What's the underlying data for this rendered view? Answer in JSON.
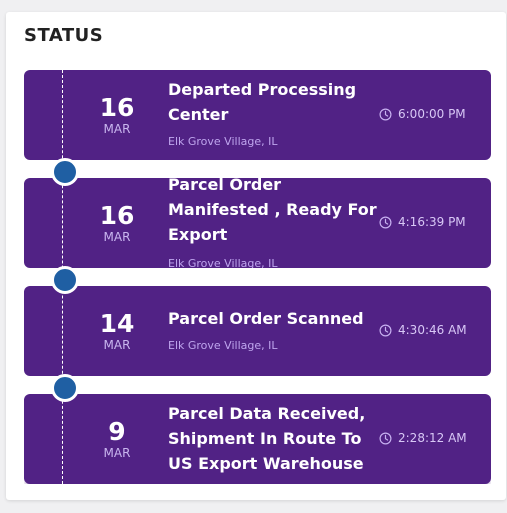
{
  "status_title": "STATUS",
  "events": [
    {
      "day": "16",
      "month": "MAR",
      "title": "Departed Processing Center",
      "location": "Elk Grove Village, IL",
      "time": "6:00:00 PM"
    },
    {
      "day": "16",
      "month": "MAR",
      "title": "Parcel Order Manifested , Ready For Export",
      "location": "Elk Grove Village, IL",
      "time": "4:16:39 PM"
    },
    {
      "day": "14",
      "month": "MAR",
      "title": "Parcel Order Scanned",
      "location": "Elk Grove Village, IL",
      "time": "4:30:46 AM"
    },
    {
      "day": "9",
      "month": "MAR",
      "title": "Parcel Data Received, Shipment In Route To US Export Warehouse",
      "location": "",
      "time": "2:28:12 AM"
    }
  ],
  "colors": {
    "card_bg": "#512285",
    "dot": "#1f5fa3",
    "page_bg": "#f0f0f2"
  },
  "icons": {
    "time": "clock-icon",
    "timeline_marker": "timeline-dot-icon"
  }
}
